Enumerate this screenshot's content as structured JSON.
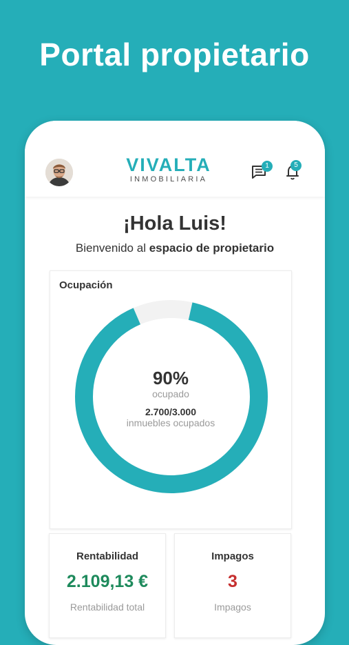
{
  "banner": {
    "title": "Portal propietario"
  },
  "header": {
    "logo_main": "VIVALTA",
    "logo_sub": "INMOBILIARIA",
    "messages_badge": "1",
    "notifications_badge": "5"
  },
  "welcome": {
    "greeting": "¡Hola Luis!",
    "intro": "Bienvenido al",
    "intro_bold": "espacio de propietario"
  },
  "occupancy": {
    "title": "Ocupación",
    "percent_value": 0.9,
    "percent_text": "90%",
    "percent_label": "ocupado",
    "units_text": "2.700/3.000",
    "units_label": "inmuebles ocupados"
  },
  "profitability": {
    "title": "Rentabilidad",
    "value": "2.109,13 €",
    "label": "Rentabilidad total"
  },
  "defaults": {
    "title": "Impagos",
    "value": "3",
    "label": "Impagos"
  },
  "colors": {
    "brand": "#25aeb8",
    "positive": "#1e8a5c",
    "negative": "#c62f2f"
  }
}
